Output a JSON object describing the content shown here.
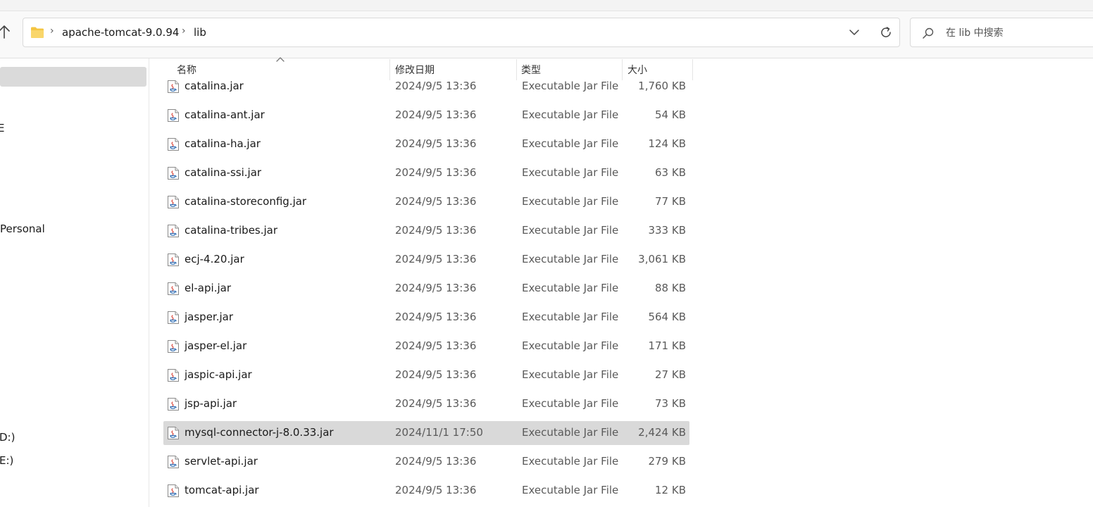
{
  "addressbar": {
    "breadcrumbs": [
      "apache-tomcat-9.0.94",
      "lib"
    ],
    "separator": "›"
  },
  "search": {
    "placeholder": "在 lib 中搜索"
  },
  "sidebar": {
    "items": [
      {
        "label": "E"
      },
      {
        "label": "Personal"
      },
      {
        "label": "D:)"
      },
      {
        "label": "E:)"
      }
    ]
  },
  "columns": {
    "name": "名称",
    "modified": "修改日期",
    "type": "类型",
    "size": "大小"
  },
  "files": [
    {
      "name": "catalina.jar",
      "modified": "2024/9/5 13:36",
      "type": "Executable Jar File",
      "size": "1,760 KB"
    },
    {
      "name": "catalina-ant.jar",
      "modified": "2024/9/5 13:36",
      "type": "Executable Jar File",
      "size": "54 KB"
    },
    {
      "name": "catalina-ha.jar",
      "modified": "2024/9/5 13:36",
      "type": "Executable Jar File",
      "size": "124 KB"
    },
    {
      "name": "catalina-ssi.jar",
      "modified": "2024/9/5 13:36",
      "type": "Executable Jar File",
      "size": "63 KB"
    },
    {
      "name": "catalina-storeconfig.jar",
      "modified": "2024/9/5 13:36",
      "type": "Executable Jar File",
      "size": "77 KB"
    },
    {
      "name": "catalina-tribes.jar",
      "modified": "2024/9/5 13:36",
      "type": "Executable Jar File",
      "size": "333 KB"
    },
    {
      "name": "ecj-4.20.jar",
      "modified": "2024/9/5 13:36",
      "type": "Executable Jar File",
      "size": "3,061 KB"
    },
    {
      "name": "el-api.jar",
      "modified": "2024/9/5 13:36",
      "type": "Executable Jar File",
      "size": "88 KB"
    },
    {
      "name": "jasper.jar",
      "modified": "2024/9/5 13:36",
      "type": "Executable Jar File",
      "size": "564 KB"
    },
    {
      "name": "jasper-el.jar",
      "modified": "2024/9/5 13:36",
      "type": "Executable Jar File",
      "size": "171 KB"
    },
    {
      "name": "jaspic-api.jar",
      "modified": "2024/9/5 13:36",
      "type": "Executable Jar File",
      "size": "27 KB"
    },
    {
      "name": "jsp-api.jar",
      "modified": "2024/9/5 13:36",
      "type": "Executable Jar File",
      "size": "73 KB"
    },
    {
      "name": "mysql-connector-j-8.0.33.jar",
      "modified": "2024/11/1 17:50",
      "type": "Executable Jar File",
      "size": "2,424 KB",
      "selected": true
    },
    {
      "name": "servlet-api.jar",
      "modified": "2024/9/5 13:36",
      "type": "Executable Jar File",
      "size": "279 KB"
    },
    {
      "name": "tomcat-api.jar",
      "modified": "2024/9/5 13:36",
      "type": "Executable Jar File",
      "size": "12 KB"
    }
  ],
  "colors": {
    "selection": "#d9d9d9",
    "folder": "#f4c542",
    "java_red": "#d9453a",
    "java_blue": "#2f6db3"
  },
  "icons": [
    "up-arrow-icon",
    "folder-icon",
    "chevron-down-icon",
    "refresh-icon",
    "search-icon",
    "jar-file-icon",
    "sort-arrow-icon"
  ]
}
